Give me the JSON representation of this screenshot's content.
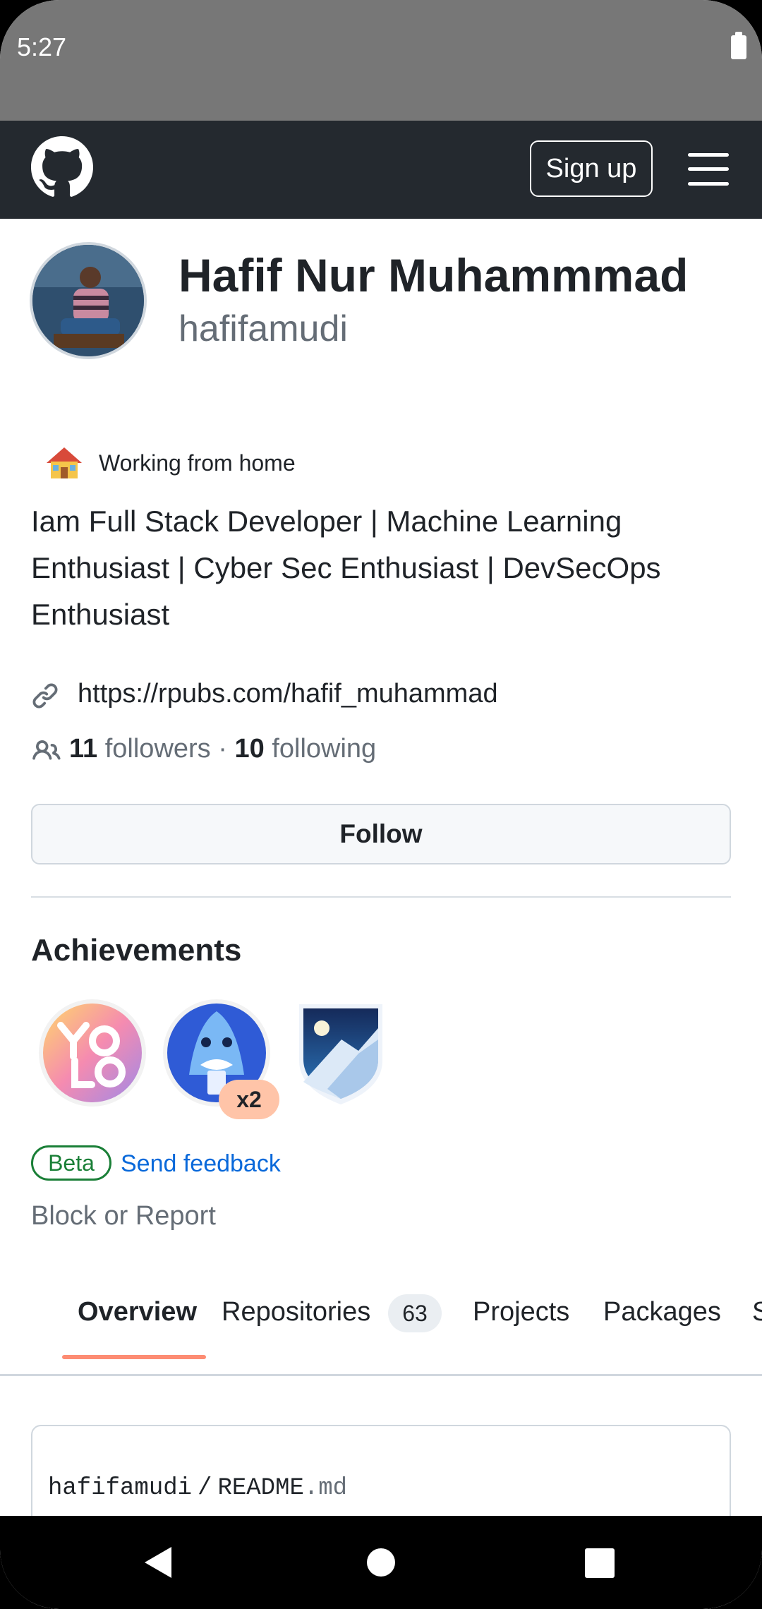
{
  "status_bar": {
    "time": "5:27"
  },
  "header": {
    "signup_label": "Sign up"
  },
  "profile": {
    "name": "Hafif Nur Muhammmad",
    "login": "hafifamudi",
    "status": "Working from home",
    "bio": "Iam Full Stack Developer | Machine Learning Enthusiast | Cyber Sec Enthusiast | DevSecOps Enthusiast",
    "website": "https://rpubs.com/hafif_muhammad",
    "followers_count": "11",
    "followers_label": "followers",
    "separator": "·",
    "following_count": "10",
    "following_label": "following",
    "follow_label": "Follow"
  },
  "achievements": {
    "title": "Achievements",
    "badges": [
      {
        "name": "YOLO",
        "count": ""
      },
      {
        "name": "Pull Shark",
        "count": "x2"
      },
      {
        "name": "Arctic Code Vault Contributor",
        "count": ""
      }
    ],
    "beta_label": "Beta",
    "feedback_label": "Send feedback"
  },
  "block_report": "Block or Report",
  "tabs": [
    {
      "label": "Overview",
      "active": true
    },
    {
      "label": "Repositories",
      "count": "63"
    },
    {
      "label": "Projects"
    },
    {
      "label": "Packages"
    },
    {
      "label": "S"
    }
  ],
  "readme": {
    "owner": "hafifamudi",
    "separator": "/",
    "file": "README",
    "ext": ".md"
  },
  "colors": {
    "header_bg": "#24292f",
    "link": "#0969da",
    "beta_green": "#1a7f37",
    "tab_underline": "#fd8c73"
  },
  "icons": [
    "github-logo-icon",
    "hamburger-menu-icon",
    "house-emoji-icon",
    "link-icon",
    "people-icon",
    "back-nav-icon",
    "home-nav-icon",
    "recents-nav-icon"
  ]
}
